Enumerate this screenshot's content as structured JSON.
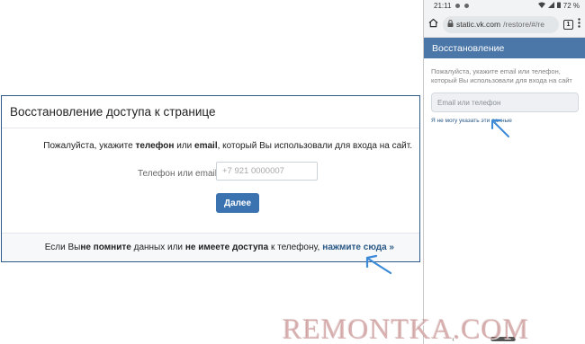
{
  "desktop": {
    "title": "Восстановление доступа к странице",
    "instruction": {
      "prefix": "Пожалуйста, укажите ",
      "bold1": "телефон",
      "middle": " или ",
      "bold2": "email",
      "suffix": ", который Вы использовали для входа на сайт."
    },
    "field_label": "Телефон или email",
    "field_placeholder": "+7 921 0000007",
    "submit_label": "Далее",
    "footer": {
      "prefix": "Если Вы ",
      "bold1": "не помните",
      "middle1": " данных или ",
      "bold2": "не имеете доступа",
      "middle2": " к телефону,",
      "link": "нажмите сюда »"
    }
  },
  "mobile": {
    "status": {
      "time": "21:11",
      "battery": "72 %"
    },
    "url": {
      "host": "static.vk.com",
      "path": "/restore/#/re"
    },
    "tab_count": "1",
    "header_title": "Восстановление",
    "instruction": "Пожалуйста, укажите email или телефон, который Вы использовали для входа на сайт",
    "field_placeholder": "Email или телефон",
    "link": "Я не могу указать эти данные"
  },
  "watermark": "REMONTKA.COM",
  "colors": {
    "vk_blue": "#4a76a8",
    "button_blue": "#3b73b1",
    "link_blue": "#2a5885",
    "arrow_blue": "#3a8ad8"
  }
}
